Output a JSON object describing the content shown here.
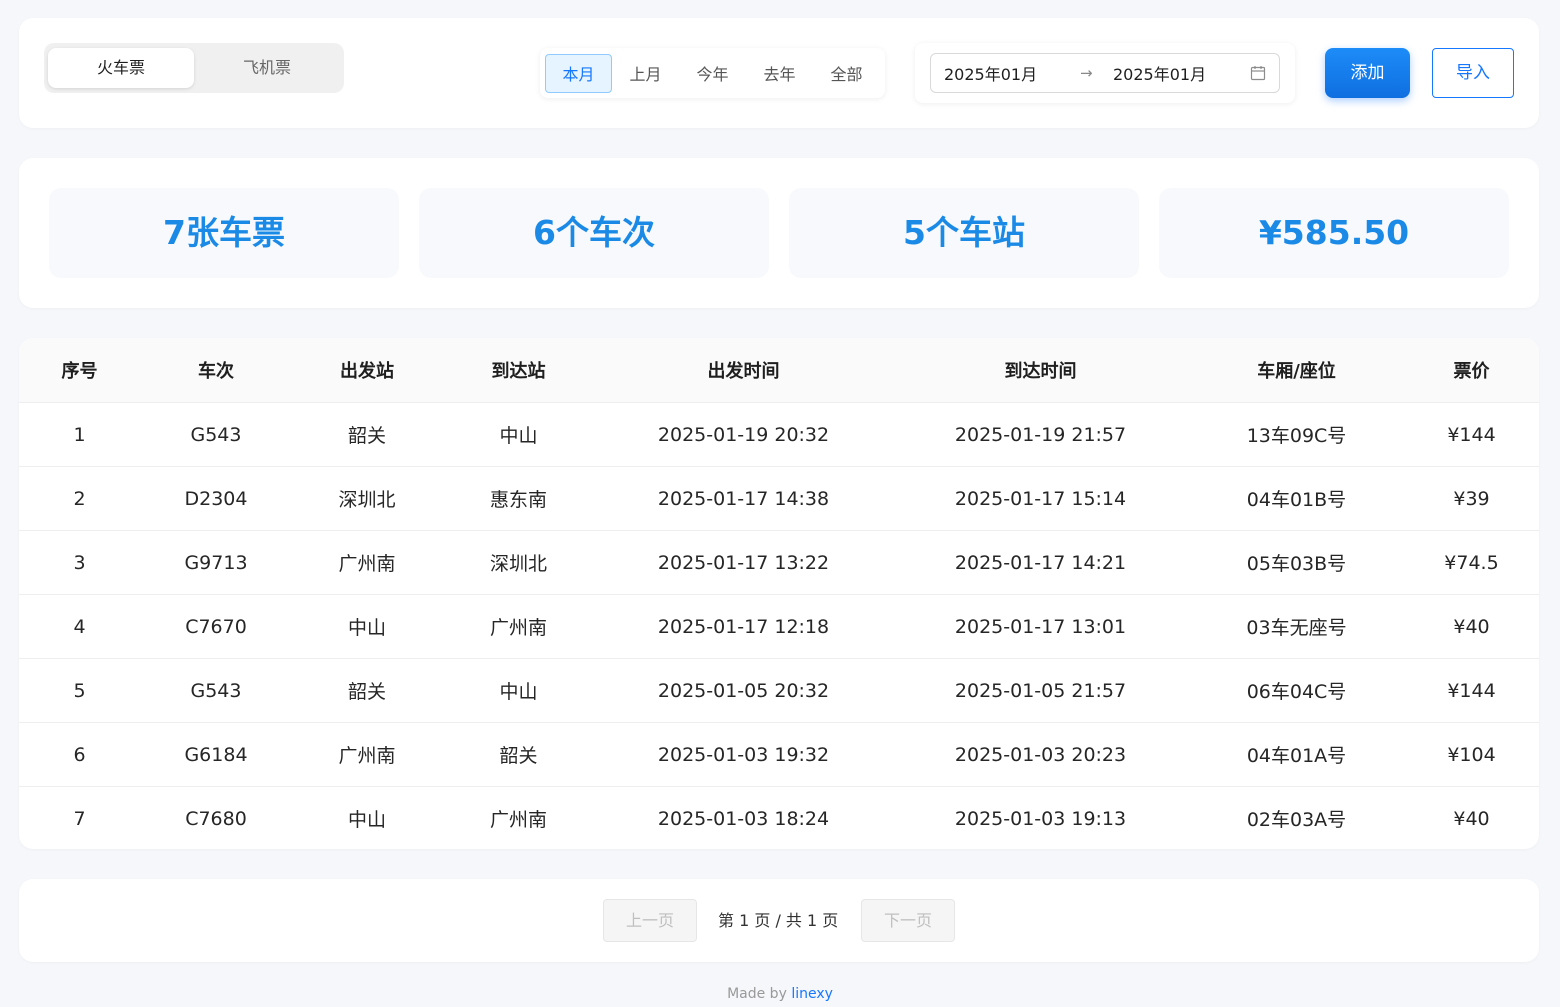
{
  "tabs": [
    {
      "label": "火车票",
      "active": true
    },
    {
      "label": "飞机票",
      "active": false
    }
  ],
  "ranges": [
    {
      "label": "本月",
      "active": true
    },
    {
      "label": "上月",
      "active": false
    },
    {
      "label": "今年",
      "active": false
    },
    {
      "label": "去年",
      "active": false
    },
    {
      "label": "全部",
      "active": false
    }
  ],
  "date_range": {
    "from": "2025年01月",
    "arrow": "→",
    "to": "2025年01月"
  },
  "actions": {
    "add_label": "添加",
    "import_label": "导入"
  },
  "stats": {
    "tickets": "7张车票",
    "trains": "6个车次",
    "stations": "5个车站",
    "total": "¥585.50"
  },
  "table": {
    "headers": [
      "序号",
      "车次",
      "出发站",
      "到达站",
      "出发时间",
      "到达时间",
      "车厢/座位",
      "票价"
    ],
    "rows": [
      [
        "1",
        "G543",
        "韶关",
        "中山",
        "2025-01-19 20:32",
        "2025-01-19 21:57",
        "13车09C号",
        "¥144"
      ],
      [
        "2",
        "D2304",
        "深圳北",
        "惠东南",
        "2025-01-17 14:38",
        "2025-01-17 15:14",
        "04车01B号",
        "¥39"
      ],
      [
        "3",
        "G9713",
        "广州南",
        "深圳北",
        "2025-01-17 13:22",
        "2025-01-17 14:21",
        "05车03B号",
        "¥74.5"
      ],
      [
        "4",
        "C7670",
        "中山",
        "广州南",
        "2025-01-17 12:18",
        "2025-01-17 13:01",
        "03车无座号",
        "¥40"
      ],
      [
        "5",
        "G543",
        "韶关",
        "中山",
        "2025-01-05 20:32",
        "2025-01-05 21:57",
        "06车04C号",
        "¥144"
      ],
      [
        "6",
        "G6184",
        "广州南",
        "韶关",
        "2025-01-03 19:32",
        "2025-01-03 20:23",
        "04车01A号",
        "¥104"
      ],
      [
        "7",
        "C7680",
        "中山",
        "广州南",
        "2025-01-03 18:24",
        "2025-01-03 19:13",
        "02车03A号",
        "¥40"
      ]
    ]
  },
  "pagination": {
    "prev_label": "上一页",
    "info": "第 1 页 / 共 1 页",
    "next_label": "下一页"
  },
  "footer": {
    "prefix": "Made by ",
    "author": "linexy"
  },
  "colors": {
    "accent": "#1677ff",
    "stat_text": "#1a8ae6"
  }
}
